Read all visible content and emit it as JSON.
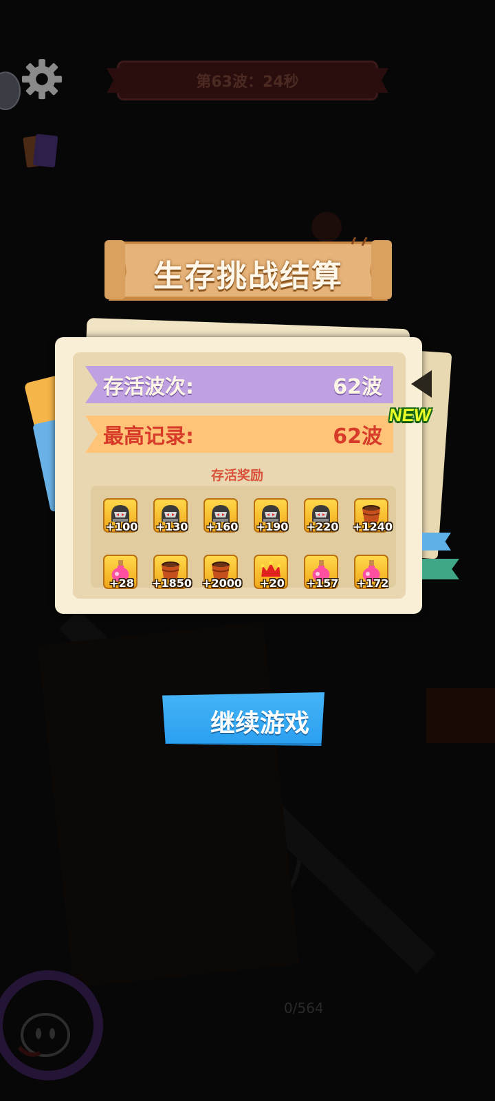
{
  "hud": {
    "wave_banner": "第63波：24秒",
    "settings_icon": "gear-icon",
    "cards_icon": "cards-icon",
    "avatar_icon": "face-icon"
  },
  "result": {
    "title": "生存挑战结算",
    "survived_label": "存活波次:",
    "survived_value": "62波",
    "record_label": "最高记录:",
    "record_value": "62波",
    "new_badge": "NEW",
    "reward_title": "存活奖励",
    "rewards": [
      {
        "icon": "helmet-icon",
        "amount": "+100"
      },
      {
        "icon": "helmet-icon",
        "amount": "+130"
      },
      {
        "icon": "helmet-icon",
        "amount": "+160"
      },
      {
        "icon": "helmet-icon",
        "amount": "+190"
      },
      {
        "icon": "helmet-icon",
        "amount": "+220"
      },
      {
        "icon": "barrel-icon",
        "amount": "+1240"
      },
      {
        "icon": "potion-icon",
        "amount": "+28"
      },
      {
        "icon": "barrel-icon",
        "amount": "+1850"
      },
      {
        "icon": "barrel-icon",
        "amount": "+2000"
      },
      {
        "icon": "crown-icon",
        "amount": "+20"
      },
      {
        "icon": "potion-icon",
        "amount": "+157"
      },
      {
        "icon": "potion-icon",
        "amount": "+172"
      }
    ]
  },
  "continue_button": "继续游戏",
  "progress": "0/564",
  "colors": {
    "purple_row": "#bfa0e0",
    "orange_row": "#ffc477",
    "button": "#2a9ff0",
    "new_badge": "#eaff2a"
  }
}
